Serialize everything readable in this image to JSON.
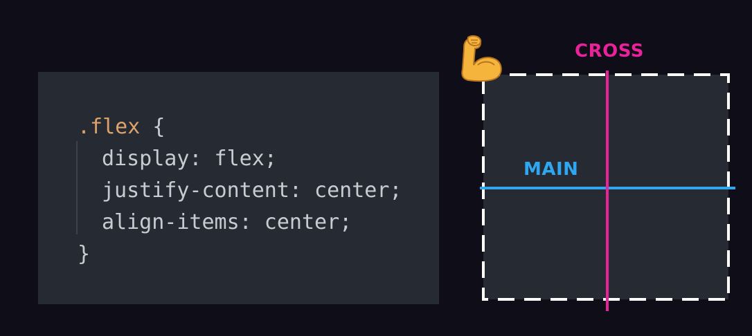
{
  "code": {
    "selector": ".flex",
    "open_brace": " {",
    "close_brace": "}",
    "declarations": [
      "display: flex;",
      "justify-content: center;",
      "align-items: center;"
    ]
  },
  "diagram": {
    "cross_axis_label": "CROSS",
    "main_axis_label": "MAIN",
    "item_icon": "flexed-biceps-icon",
    "colors": {
      "cross_axis": "#e8239a",
      "main_axis": "#2fa6f0",
      "container_fill": "#262b33",
      "container_border": "#ffffff"
    }
  }
}
